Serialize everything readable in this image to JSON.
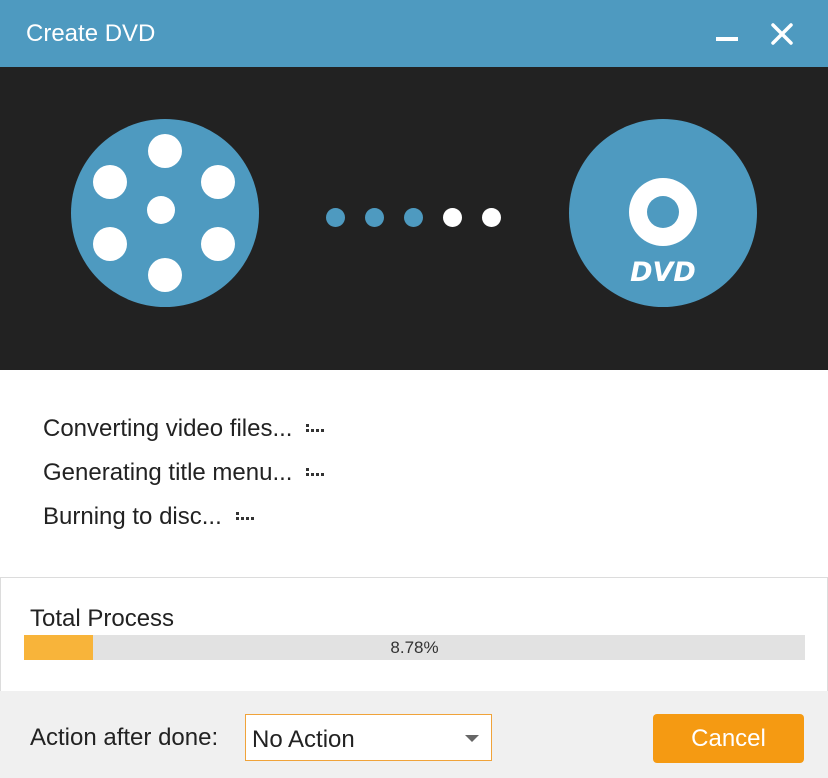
{
  "window": {
    "title": "Create DVD",
    "minimize_icon": "minimize-icon",
    "close_icon": "close-icon"
  },
  "banner": {
    "source_icon": "film-reel-icon",
    "target_icon": "dvd-disc-icon",
    "dvd_logo_text": "DVD",
    "progress_dots": [
      {
        "state": "active"
      },
      {
        "state": "active"
      },
      {
        "state": "active"
      },
      {
        "state": "pending"
      },
      {
        "state": "pending"
      }
    ]
  },
  "steps": [
    {
      "label": "Converting video files...",
      "icon": "loading-dots-icon"
    },
    {
      "label": "Generating title menu...",
      "icon": "loading-dots-icon"
    },
    {
      "label": "Burning to disc...",
      "icon": "loading-dots-icon"
    }
  ],
  "total_process": {
    "label": "Total Process",
    "percent_text": "8.78%",
    "fraction": 0.0878
  },
  "footer": {
    "action_label": "Action after done:",
    "action_selected": "No Action",
    "cancel_label": "Cancel"
  },
  "colors": {
    "titlebar": "#4e9ac0",
    "accent_blue": "#4e9ac0",
    "banner_bg": "#222222",
    "progress_fill": "#f8b43a",
    "cancel_button": "#f59a12",
    "select_border": "#f0a33a"
  }
}
